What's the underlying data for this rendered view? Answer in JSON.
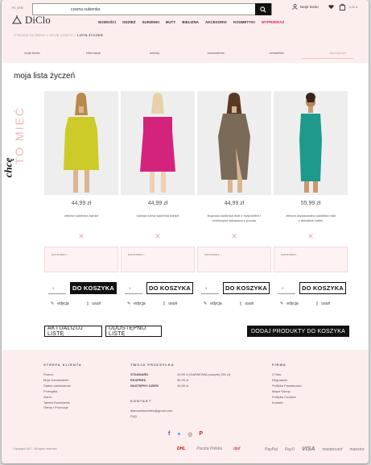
{
  "header": {
    "lang": "PL | EN",
    "logo_text": "DiClo",
    "search_value": "czarna sukienka",
    "account_label": "twoje konto",
    "cart_value": "0,00 zł"
  },
  "nav": [
    "NOWOŚCI",
    "ODZIEŻ",
    "SUKIENKI",
    "BUTY",
    "BIELIZNA",
    "AKCESORIA",
    "KOSMETYKI",
    "WYPRZEDAŻ"
  ],
  "breadcrumb": {
    "home": "STRONA GŁÓWNA",
    "sep": "»",
    "account": "MOJE KONTO",
    "current": "LISTA ŻYCZEŃ"
  },
  "tabs": [
    "moje konto",
    "informacje",
    "adresy",
    "zamówienia",
    "newsletter",
    "lista życzeń"
  ],
  "page_title": "moja lista życzeń",
  "side_text": {
    "a": "chcę",
    "b": "TO MIEĆ"
  },
  "products": [
    {
      "price": "44,99 zł",
      "name": "zielona sukienka bardot",
      "name2": "",
      "comment_placeholder": "komentarz...",
      "qty": "1",
      "cart_label": "DO KOSZYKA",
      "dress_color": "#cccb2a"
    },
    {
      "price": "44,99 zł",
      "name": "różowa luźna sukienka bardot",
      "name2": "",
      "comment_placeholder": "komentarz...",
      "qty": "1",
      "cart_label": "DO KOSZYKA",
      "dress_color": "#d4237c"
    },
    {
      "price": "44,99 zł",
      "name": "brązowa sukienka midi z rozporkiem i",
      "name2": "ozdobnymi falbanami z przodu",
      "comment_placeholder": "komentarz...",
      "qty": "1",
      "cart_label": "DO KOSZYKA",
      "dress_color": "#7a6a58"
    },
    {
      "price": "55,99 zł",
      "name": "zielona dopasowana sukienka midi",
      "name2": "z dekoltem halter",
      "comment_placeholder": "komentarz...",
      "qty": "1",
      "cart_label": "DO KOSZYKA",
      "dress_color": "#1e9a8c"
    }
  ],
  "actions": {
    "edit": "edycja",
    "remove": "usuń"
  },
  "buttons": {
    "update": "AKTUALIZUJ LISTĘ",
    "share": "UDOSTĘPNIJ LISTĘ",
    "add_all": "DODAJ PRODUKTY DO KOSZYKA"
  },
  "footer": {
    "col1_title": "STREFA KLIENTA",
    "col1_links": [
      "Pomoc",
      "Moje Zamówienie",
      "Status zamówienia",
      "Przesyłka",
      "Zwrot",
      "Tabela Rozmiarów",
      "Oferty i Promocje"
    ],
    "col2_title": "TWOJA PRZESYŁKA",
    "shipping": [
      {
        "label": "STANDARD",
        "value": "15,99 zł (DARMOWA powyżej 250 zł)"
      },
      {
        "label": "EKSPRES",
        "value": "35,99 zł"
      },
      {
        "label": "NASTĘPNY DZIEŃ",
        "value": "45,99 zł"
      }
    ],
    "contact_title": "KONTAKT",
    "contact_email": "diamondsclothes@gmail.com",
    "faq": "FAQ",
    "col3_title": "FIRMA",
    "col3_links": [
      "O Nas",
      "Regulamin",
      "Polityka Prywatności",
      "Mapa Strony",
      "Polityka Cookies",
      "Kontakt"
    ],
    "copyright": "Copyright 2017 . All rights reserved",
    "carriers": [
      "DHL",
      "Poczta Polska",
      "dpd"
    ],
    "payments": [
      "PayPal",
      "PayU",
      "VISA",
      "mastercard",
      "maestro"
    ]
  }
}
